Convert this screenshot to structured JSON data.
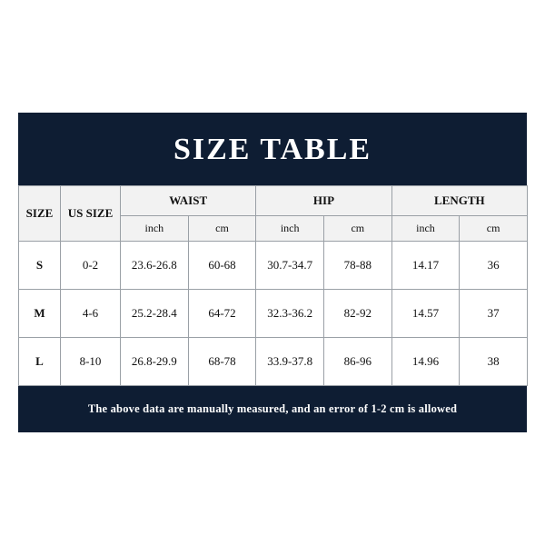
{
  "title": "SIZE TABLE",
  "headers": {
    "size": "SIZE",
    "us_size": "US SIZE",
    "waist": "WAIST",
    "hip": "HIP",
    "length": "LENGTH",
    "inch": "inch",
    "cm": "cm"
  },
  "rows": [
    {
      "size": "S",
      "us_size": "0-2",
      "waist_in": "23.6-26.8",
      "waist_cm": "60-68",
      "hip_in": "30.7-34.7",
      "hip_cm": "78-88",
      "len_in": "14.17",
      "len_cm": "36"
    },
    {
      "size": "M",
      "us_size": "4-6",
      "waist_in": "25.2-28.4",
      "waist_cm": "64-72",
      "hip_in": "32.3-36.2",
      "hip_cm": "82-92",
      "len_in": "14.57",
      "len_cm": "37"
    },
    {
      "size": "L",
      "us_size": "8-10",
      "waist_in": "26.8-29.9",
      "waist_cm": "68-78",
      "hip_in": "33.9-37.8",
      "hip_cm": "86-96",
      "len_in": "14.96",
      "len_cm": "38"
    }
  ],
  "footer": "The above data are manually measured, and an error of 1-2 cm is allowed"
}
